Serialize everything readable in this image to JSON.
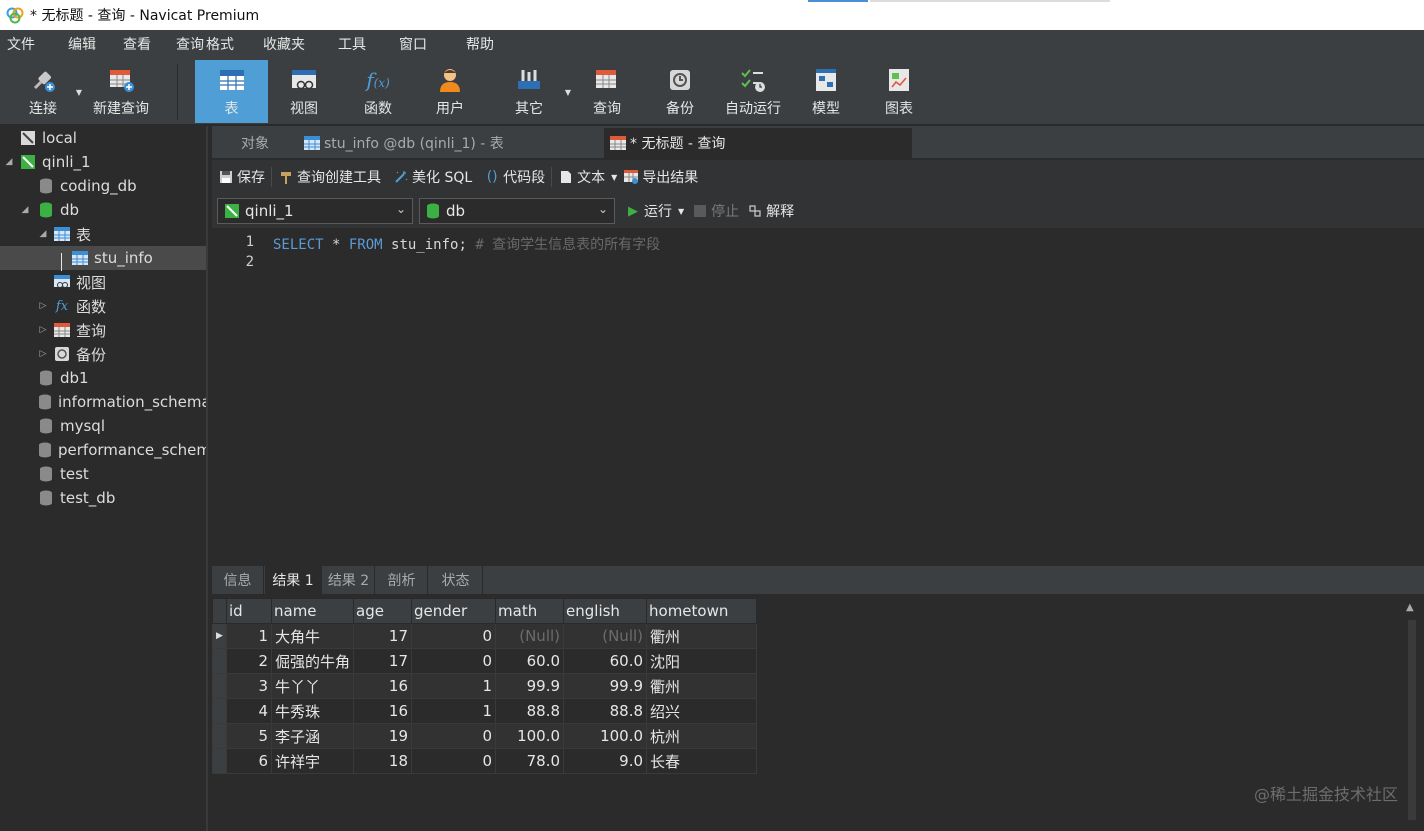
{
  "window": {
    "title": "* 无标题 - 查询 - Navicat Premium"
  },
  "menu": [
    "文件",
    "编辑",
    "查看",
    "查询",
    "格式",
    "收藏夹",
    "工具",
    "窗口",
    "帮助"
  ],
  "toolbar": {
    "connect": "连接",
    "new_query": "新建查询",
    "table": "表",
    "view": "视图",
    "function": "函数",
    "user": "用户",
    "other": "其它",
    "query": "查询",
    "backup": "备份",
    "auto_run": "自动运行",
    "model": "模型",
    "chart": "图表"
  },
  "sidebar": {
    "items": [
      {
        "label": "local"
      },
      {
        "label": "qinli_1"
      },
      {
        "label": "coding_db"
      },
      {
        "label": "db"
      },
      {
        "label": "表"
      },
      {
        "label": "stu_info"
      },
      {
        "label": "视图"
      },
      {
        "label": "函数"
      },
      {
        "label": "查询"
      },
      {
        "label": "备份"
      },
      {
        "label": "db1"
      },
      {
        "label": "information_schema"
      },
      {
        "label": "mysql"
      },
      {
        "label": "performance_schem"
      },
      {
        "label": "test"
      },
      {
        "label": "test_db"
      }
    ]
  },
  "tabs": {
    "objects": "对象",
    "stu_info": "stu_info @db (qinli_1) - 表",
    "query": "* 无标题 - 查询"
  },
  "query_toolbar": {
    "save": "保存",
    "builder": "查询创建工具",
    "beautify": "美化 SQL",
    "snippet": "代码段",
    "text": "文本",
    "export": "导出结果"
  },
  "conn_bar": {
    "connection": "qinli_1",
    "database": "db",
    "run": "运行",
    "stop": "停止",
    "explain": "解释"
  },
  "editor": {
    "line1_no": "1",
    "line2_no": "2",
    "kw_select": "SELECT",
    "star": " * ",
    "kw_from": "FROM",
    "table": " stu_info;",
    "comment": " # 查询学生信息表的所有字段"
  },
  "result_tabs": [
    "信息",
    "结果 1",
    "结果 2",
    "剖析",
    "状态"
  ],
  "grid": {
    "columns": [
      "id",
      "name",
      "age",
      "gender",
      "math",
      "english",
      "hometown"
    ],
    "rows": [
      [
        "1",
        "大角牛",
        "17",
        "0",
        "(Null)",
        "(Null)",
        "衢州"
      ],
      [
        "2",
        "倔强的牛角",
        "17",
        "0",
        "60.0",
        "60.0",
        "沈阳"
      ],
      [
        "3",
        "牛丫丫",
        "16",
        "1",
        "99.9",
        "99.9",
        "衢州"
      ],
      [
        "4",
        "牛秀珠",
        "16",
        "1",
        "88.8",
        "88.8",
        "绍兴"
      ],
      [
        "5",
        "李子涵",
        "19",
        "0",
        "100.0",
        "100.0",
        "杭州"
      ],
      [
        "6",
        "许祥宇",
        "18",
        "0",
        "78.0",
        "9.0",
        "长春"
      ]
    ]
  },
  "watermark": "@稀土掘金技术社区"
}
